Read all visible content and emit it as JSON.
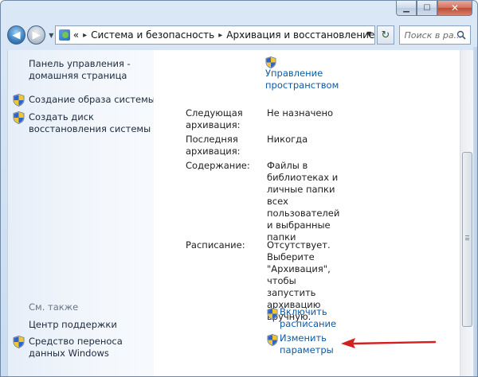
{
  "window": {
    "caption": {
      "minimize": "▁",
      "maximize": "☐",
      "close": "✕"
    }
  },
  "address_bar": {
    "overflow": "«",
    "crumbs": [
      "Система и безопасность",
      "Архивация и восстановление"
    ],
    "search_placeholder": "Поиск в ра..."
  },
  "left_pane": {
    "home_link": "Панель управления - домашняя страница",
    "tasks": [
      {
        "label": "Создание образа системы",
        "icon": "shield-icon"
      },
      {
        "label": "Создать диск восстановления системы",
        "icon": "shield-icon"
      }
    ],
    "see_also_header": "См. также",
    "see_also": [
      {
        "label": "Центр поддержки"
      },
      {
        "label": "Средство переноса данных Windows",
        "icon": "shield-icon"
      }
    ]
  },
  "main": {
    "manage_space_link": "Управление пространством",
    "rows": [
      {
        "label": "Следующая архивация:",
        "value": "Не назначено"
      },
      {
        "label": "Последняя архивация:",
        "value": "Никогда"
      },
      {
        "label": "Содержание:",
        "value": "Файлы в библиотеках и личные папки всех пользователей и выбранные папки"
      },
      {
        "label": "Расписание:",
        "value": "Отсутствует. Выберите \"Архивация\", чтобы запустить архивацию вручную."
      }
    ],
    "enable_schedule_link": "Включить расписание",
    "change_settings_link": "Изменить параметры"
  },
  "colors": {
    "link": "#0d5aa7",
    "annotation_arrow": "#d21f1f",
    "left_pane_bg": "#eef4fb"
  }
}
